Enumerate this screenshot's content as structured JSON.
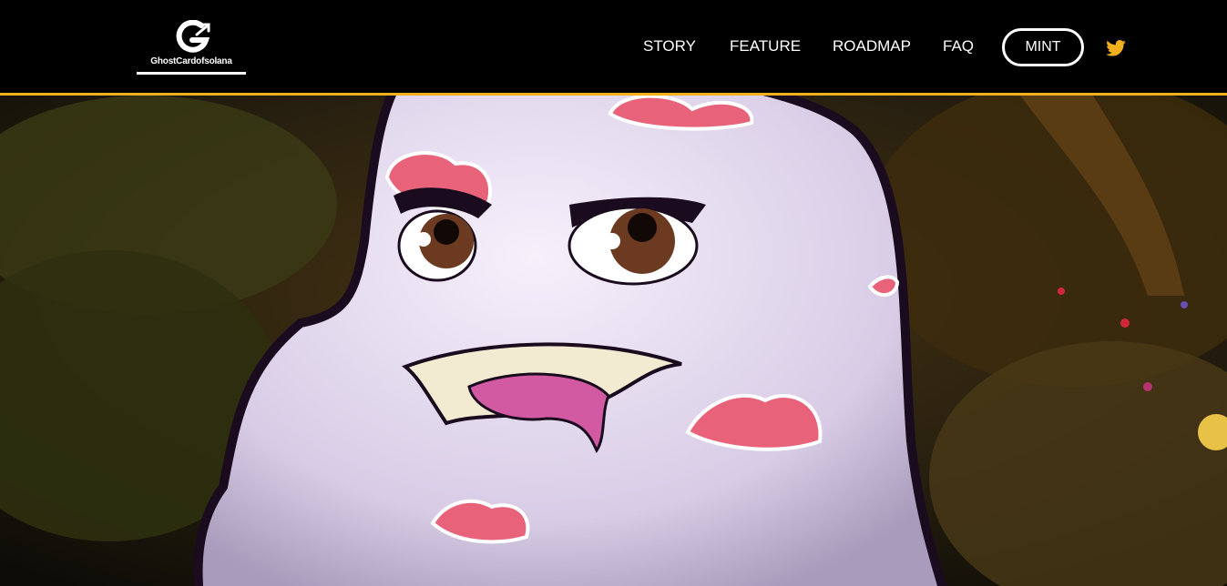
{
  "brand": {
    "name": "GhostCardofsolana",
    "accent": "#f2b01e"
  },
  "nav": {
    "items": [
      {
        "label": "STORY"
      },
      {
        "label": "FEATURE"
      },
      {
        "label": "ROADMAP"
      },
      {
        "label": "FAQ"
      }
    ],
    "mint_label": "MINT",
    "social_icon": "twitter-icon"
  },
  "hero": {
    "image": "ghost-mascot-forest-illustration"
  }
}
